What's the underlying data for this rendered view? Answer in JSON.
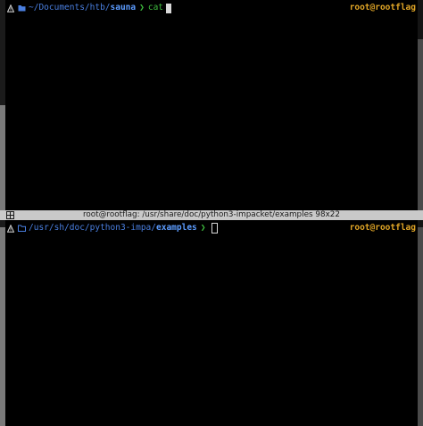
{
  "top_pane": {
    "path_prefix": "~/Documents/htb/",
    "path_current": "sauna",
    "prompt_arrow": "❯",
    "command": "cat",
    "host": "root@rootflag"
  },
  "divider": {
    "title": "root@rootflag: /usr/share/doc/python3-impacket/examples 98x22"
  },
  "bottom_pane": {
    "path_prefix": "/usr/sh/doc/python3-impa/",
    "path_current": "examples",
    "prompt_arrow": "❯",
    "host": "root@rootflag"
  },
  "icons": {
    "prompt_status": "warning-triangle-icon",
    "directory": "folder-icon",
    "pane_layout": "split-grid-icon"
  },
  "colors": {
    "background": "#000000",
    "path": "#4a7fe0",
    "command": "#3fbf3f",
    "host": "#e0a526",
    "divider": "#c9c9c9"
  }
}
